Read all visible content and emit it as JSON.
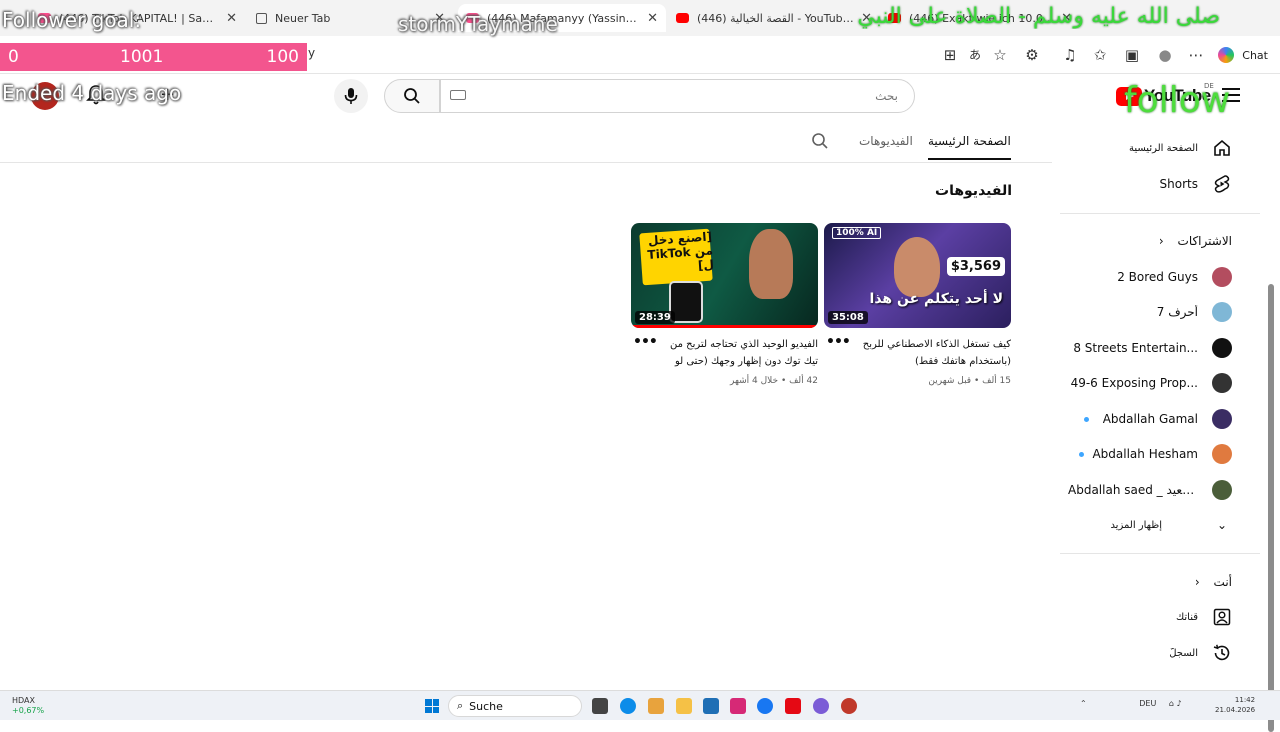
{
  "browser": {
    "tabs": [
      {
        "title": "(446) TikTok KAPITAL! | Sami Stream",
        "active": false
      },
      {
        "title": "Neuer Tab",
        "active": false
      },
      {
        "title": "(446) Mafamanyy (Yassine) - YouTube",
        "active": true
      },
      {
        "title": "(446) القصة الخيالية - YouTube طاحون",
        "active": false
      },
      {
        "title": "(446) Exakt wie ich 10.000€ pro Monat",
        "active": false
      }
    ],
    "address_fragment": "y",
    "chat_label": "Chat"
  },
  "overlays": {
    "follower_goal_label": "Follower goal:",
    "goal_left": "0",
    "goal_mid": "1001",
    "goal_right": "100",
    "ended_label": "Ended 4 days ago",
    "streamer_name": "stormYTaymane",
    "follow_label": "follow",
    "arabic_banner": "صلى الله عليه وسلم - الصلاة على النبي"
  },
  "youtube": {
    "logo_text": "YouTube",
    "region": "DE",
    "search_placeholder": "بحث",
    "channel_tabs": {
      "home": "الصفحة الرئيسية",
      "videos": "الفيديوهات"
    },
    "section_title": "الفيديوهات",
    "videos": [
      {
        "thumb_text": "لا أحد يتكلم عن هذا",
        "badge": "100% AI",
        "earnings": "$3,569",
        "duration": "35:08",
        "title": "كيف تستغل الذكاء الاصطناعي للربح (باستخدام هاتفك فقط)",
        "stats": "15 ألف • قبل شهرين"
      },
      {
        "thumb_text": "[اصنع دخل من TikTok ل]",
        "badge": "",
        "earnings": "",
        "duration": "28:39",
        "title": "الفيديو الوحيد الذي تحتاجه لتربح من تيك توك دون إظهار وجهك (حتى لو بدأت م...",
        "stats": "42 ألف • خلال 4 أشهر"
      }
    ],
    "sidebar": {
      "home": "الصفحة الرئيسية",
      "shorts": "Shorts",
      "subscriptions_header": "الاشتراكات",
      "subscriptions": [
        {
          "name": "2 Bored Guys",
          "new": false,
          "color": "#b34d5f"
        },
        {
          "name": "7 أحرف",
          "new": false,
          "color": "#7fb7d6"
        },
        {
          "name": "8 Streets Entertain...",
          "new": false,
          "color": "#111111"
        },
        {
          "name": "49-6 Exposing Prop...",
          "new": false,
          "color": "#333333"
        },
        {
          "name": "Abdallah Gamal",
          "new": true,
          "color": "#3a2d63"
        },
        {
          "name": "Abdallah Hesham",
          "new": true,
          "color": "#e07a3f"
        },
        {
          "name": "Abdallah saed _ سعيد...",
          "new": false,
          "color": "#4b5e3a"
        }
      ],
      "show_more": "إظهار المزيد",
      "you_header": "أنت",
      "your_channel": "قناتك",
      "history": "السجلّ"
    }
  },
  "taskbar": {
    "stock_name": "HDAX",
    "stock_change": "+0,67%",
    "search_label": "Suche",
    "lang": "DEU",
    "time": "11:42",
    "date": "21.04.2026"
  }
}
